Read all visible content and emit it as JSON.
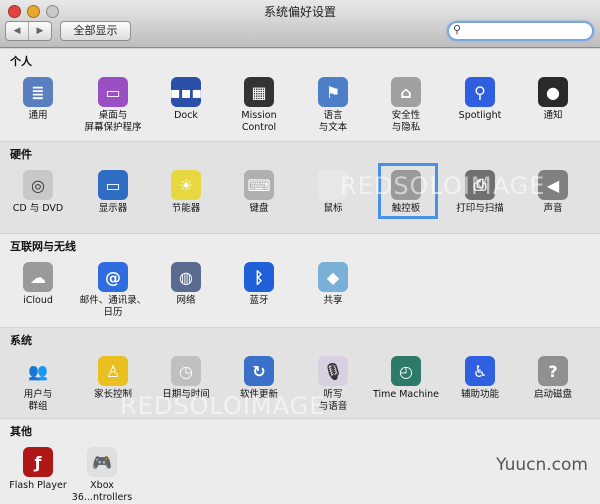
{
  "window": {
    "title": "系统偏好设置",
    "back": "◀",
    "forward": "▶",
    "show_all": "全部显示",
    "search_placeholder": "",
    "search_icon": "magnifier-icon"
  },
  "colors": {
    "close": "#e0443e",
    "minimize": "#e8a830",
    "zoom": "#b8b8b8",
    "selection": "#4a90e8"
  },
  "sections": [
    {
      "title": "个人",
      "items": [
        {
          "label": "通用",
          "icon": "general-icon",
          "color": "#5a7fc0",
          "glyph": "≣"
        },
        {
          "label": "桌面与\n屏幕保护程序",
          "icon": "desktop-icon",
          "color": "#9a4fc4",
          "glyph": "▭"
        },
        {
          "label": "Dock",
          "icon": "dock-icon",
          "color": "#2c4fa8",
          "glyph": "▪▪▪"
        },
        {
          "label": "Mission\nControl",
          "icon": "mission-control-icon",
          "color": "#333",
          "glyph": "▦"
        },
        {
          "label": "语言\n与文本",
          "icon": "language-flag-icon",
          "color": "#4d7ec8",
          "glyph": "⚑"
        },
        {
          "label": "安全性\n与隐私",
          "icon": "security-house-icon",
          "color": "#a0a0a0",
          "glyph": "⌂"
        },
        {
          "label": "Spotlight",
          "icon": "spotlight-icon",
          "color": "#2f5fe0",
          "glyph": "⚲"
        },
        {
          "label": "通知",
          "icon": "notifications-icon",
          "color": "#2a2a2a",
          "glyph": "●"
        }
      ]
    },
    {
      "title": "硬件",
      "items": [
        {
          "label": "CD 与 DVD",
          "icon": "cd-dvd-icon",
          "color": "#c8c8c8",
          "glyph": "◎"
        },
        {
          "label": "显示器",
          "icon": "display-icon",
          "color": "#2f6cc4",
          "glyph": "▭"
        },
        {
          "label": "节能器",
          "icon": "energy-bulb-icon",
          "color": "#e8d840",
          "glyph": "☀"
        },
        {
          "label": "键盘",
          "icon": "keyboard-icon",
          "color": "#b0b0b0",
          "glyph": "⌨"
        },
        {
          "label": "鼠标",
          "icon": "mouse-icon",
          "color": "#e8e8e8",
          "glyph": ""
        },
        {
          "label": "触控板",
          "icon": "trackpad-icon",
          "color": "#9a9a9a",
          "glyph": ""
        },
        {
          "label": "打印与扫描",
          "icon": "printer-icon",
          "color": "#707070",
          "glyph": "⎙"
        },
        {
          "label": "声音",
          "icon": "speaker-icon",
          "color": "#808080",
          "glyph": "◀"
        }
      ]
    },
    {
      "title": "互联网与无线",
      "items": [
        {
          "label": "iCloud",
          "icon": "icloud-icon",
          "color": "#9a9a9a",
          "glyph": "☁"
        },
        {
          "label": "邮件、通讯录、\n日历",
          "icon": "mail-at-icon",
          "color": "#2f6ce0",
          "glyph": "@"
        },
        {
          "label": "网络",
          "icon": "network-globe-icon",
          "color": "#5a6a90",
          "glyph": "◍"
        },
        {
          "label": "蓝牙",
          "icon": "bluetooth-icon",
          "color": "#1f5fd8",
          "glyph": "ᛒ"
        },
        {
          "label": "共享",
          "icon": "sharing-folder-icon",
          "color": "#7ab0d8",
          "glyph": "◆"
        }
      ]
    },
    {
      "title": "系统",
      "items": [
        {
          "label": "用户与\n群组",
          "icon": "users-icon",
          "color": "#e2e2e2",
          "glyph": "👥"
        },
        {
          "label": "家长控制",
          "icon": "parental-controls-icon",
          "color": "#e8c020",
          "glyph": "♙"
        },
        {
          "label": "日期与时间",
          "icon": "date-time-clock-icon",
          "color": "#c0c0c0",
          "glyph": "◷"
        },
        {
          "label": "软件更新",
          "icon": "software-update-icon",
          "color": "#3a70c8",
          "glyph": "↻"
        },
        {
          "label": "听写\n与语音",
          "icon": "microphone-icon",
          "color": "#d8d0e0",
          "glyph": "🎙"
        },
        {
          "label": "Time Machine",
          "icon": "time-machine-icon",
          "color": "#2e7a6a",
          "glyph": "◴"
        },
        {
          "label": "辅助功能",
          "icon": "accessibility-icon",
          "color": "#2f60e0",
          "glyph": "♿"
        },
        {
          "label": "启动磁盘",
          "icon": "startup-disk-icon",
          "color": "#909090",
          "glyph": "?"
        }
      ]
    },
    {
      "title": "其他",
      "items": [
        {
          "label": "Flash Player",
          "icon": "flash-player-icon",
          "color": "#b01818",
          "glyph": "ƒ"
        },
        {
          "label": "Xbox 36...ntrollers",
          "icon": "xbox-controller-icon",
          "color": "#e0e0e0",
          "glyph": "🎮"
        }
      ]
    }
  ],
  "watermarks": [
    "REDSOLOIMAGE",
    "REDSOLOIMAGE",
    "Yuucn.com"
  ]
}
